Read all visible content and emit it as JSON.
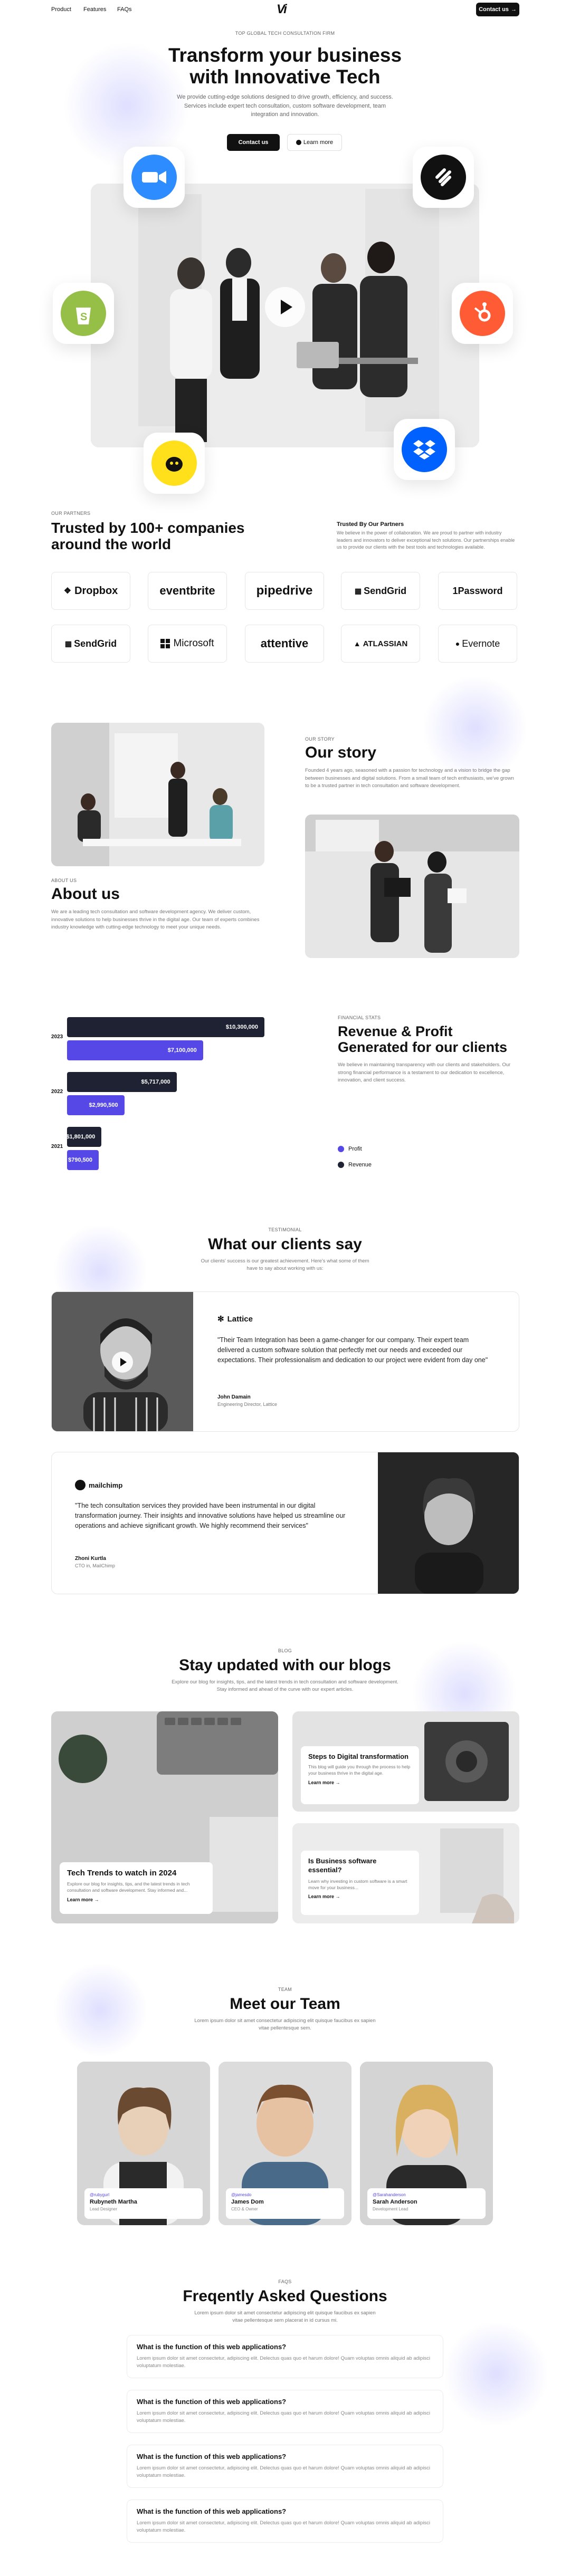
{
  "nav": {
    "links": [
      "Product",
      "Features",
      "FAQs"
    ],
    "logo": "Vi",
    "cta": "Contact us"
  },
  "hero": {
    "tag": "TOP GLOBAL TECH CONSULTATION FIRM",
    "title_line1": "Transform your business",
    "title_line2": "with Innovative Tech",
    "description": "We provide cutting-edge solutions designed to drive growth, efficiency, and success. Services include expert tech consultation, custom software development, team integration and innovation.",
    "primary_button": "Contact us",
    "secondary_button": "Learn more"
  },
  "partners": {
    "tag": "OUR PARTNERS",
    "title": "Trusted by 100+ companies around the world",
    "side_title": "Trusted By Our Partners",
    "side_text": "We believe in the power of collaboration. We are proud to partner with industry leaders and innovators to deliver exceptional tech solutions. Our partnerships enable us to provide our clients with the best tools and technologies available.",
    "logos": [
      "Dropbox",
      "eventbrite",
      "pipedrive",
      "SendGrid",
      "1Password",
      "SendGrid",
      "Microsoft",
      "attentive",
      "ATLASSIAN",
      "Evernote"
    ]
  },
  "story": {
    "tag": "OUR STORY",
    "title": "Our story",
    "text": "Founded 4 years ago, seasoned with a passion for technology and a vision to bridge the gap between businesses and digital solutions. From a small team of tech enthusiasts, we've grown to be a trusted partner in tech consultation and software development."
  },
  "about": {
    "tag": "ABOUT US",
    "title": "About us",
    "text": "We are a leading tech consultation and software development agency. We deliver custom, innovative solutions to help businesses thrive in the digital age. Our team of experts combines industry knowledge with cutting-edge technology to meet your unique needs."
  },
  "finance": {
    "tag": "FINANCIAL STATS",
    "title": "Revenue & Profit Generated for our clients",
    "text": "We believe in maintaining transparency with our clients and stakeholders. Our strong financial performance is a testament to our dedication to excellence, innovation, and client success.",
    "legend": [
      "Profit",
      "Revenue"
    ]
  },
  "chart_data": {
    "type": "bar",
    "categories": [
      "2023",
      "2022",
      "2021"
    ],
    "series": [
      {
        "name": "Revenue",
        "values": [
          10300000,
          5717000,
          1801000
        ],
        "labels": [
          "$10,300,000",
          "$5,717,000",
          "$1,801,000"
        ]
      },
      {
        "name": "Profit",
        "values": [
          7100000,
          2990500,
          790500
        ],
        "labels": [
          "$7,100,000",
          "$2,990,500",
          "$790,500"
        ]
      }
    ],
    "xlim": [
      0,
      10300000
    ]
  },
  "testimonials": {
    "tag": "TESTIMONIAL",
    "title": "What our clients say",
    "subtitle": "Our clients' success is our greatest achievement. Here's what some of them have to say about working with us:",
    "items": [
      {
        "company": "Lattice",
        "quote": "\"Their Team Integration has been a game-changer for our company. Their expert team delivered a custom software solution that perfectly met our needs and exceeded our expectations. Their professionalism and dedication to our project were evident from day one\"",
        "name": "John Damain",
        "role": "Engineering Director, Lattice"
      },
      {
        "company": "mailchimp",
        "quote": "\"The tech consultation services they provided have been instrumental in our digital transformation journey. Their insights and innovative solutions have helped us streamline our operations and achieve significant growth. We highly recommend their services\"",
        "name": "Zhoni Kurtla",
        "role": "CTO in, MailChimp"
      }
    ]
  },
  "blog": {
    "tag": "BLOG",
    "title": "Stay updated with our blogs",
    "subtitle": "Explore our blog for insights, tips, and the latest trends in tech consultation and software development. Stay informed and ahead of the curve with our expert articles.",
    "posts": [
      {
        "title": "Tech Trends to watch in 2024",
        "excerpt": "Explore our blog for insights, tips, and the latest trends in tech consultation and software development. Stay informed and...",
        "link": "Learn more"
      },
      {
        "title": "Steps to Digital transformation",
        "excerpt": "This blog will guide you through the process to help your business thrive in the digital age.",
        "link": "Learn more"
      },
      {
        "title": "Is Business software essential?",
        "excerpt": "Learn why investing in custom software is a smart move for your business...",
        "link": "Learn more"
      }
    ]
  },
  "team": {
    "tag": "TEAM",
    "title": "Meet our Team",
    "subtitle": "Lorem ipsum dolor sit amet consectetur adipiscing elit quisque faucibus ex sapien vitae pellentesque sem.",
    "members": [
      {
        "handle": "@rubygurl",
        "name": "Rubyneth Martha",
        "role": "Lead Designer"
      },
      {
        "handle": "@jamesdo",
        "name": "James Dom",
        "role": "CEO & Owner"
      },
      {
        "handle": "@Sarahanderson",
        "name": "Sarah Anderson",
        "role": "Development Lead"
      }
    ]
  },
  "faq": {
    "tag": "FAQS",
    "title": "Freqently Asked Questions",
    "subtitle": "Lorem ipsum dolor sit amet consectetur adipiscing elit quisque faucibus ex sapien vitae pellentesque sem placerat in id cursus mi.",
    "items": [
      {
        "q": "What is the function of this web applications?",
        "a": "Lorem ipsum dolor sit amet consectetur, adipiscing elit. Delectus quas quo et harum dolore! Quam voluptas omnis aliquid ab adipisci voluptatum molestiae."
      },
      {
        "q": "What is the function of this web applications?",
        "a": "Lorem ipsum dolor sit amet consectetur, adipiscing elit. Delectus quas quo et harum dolore! Quam voluptas omnis aliquid ab adipisci voluptatum molestiae."
      },
      {
        "q": "What is the function of this web applications?",
        "a": "Lorem ipsum dolor sit amet consectetur, adipiscing elit. Delectus quas quo et harum dolore! Quam voluptas omnis aliquid ab adipisci voluptatum molestiae."
      },
      {
        "q": "What is the function of this web applications?",
        "a": "Lorem ipsum dolor sit amet consectetur, adipiscing elit. Delectus quas quo et harum dolore! Quam voluptas omnis aliquid ab adipisci voluptatum molestiae."
      }
    ]
  },
  "colors": {
    "dark_bar": "#1f2232",
    "purple_bar": "#5548e6",
    "accent_blob": "#8c8cff"
  },
  "icons": [
    "zoom-icon",
    "squarespace-icon",
    "shopify-icon",
    "hubspot-icon",
    "mailchimp-icon",
    "dropbox-icon",
    "play-icon",
    "arrow-right-icon"
  ]
}
